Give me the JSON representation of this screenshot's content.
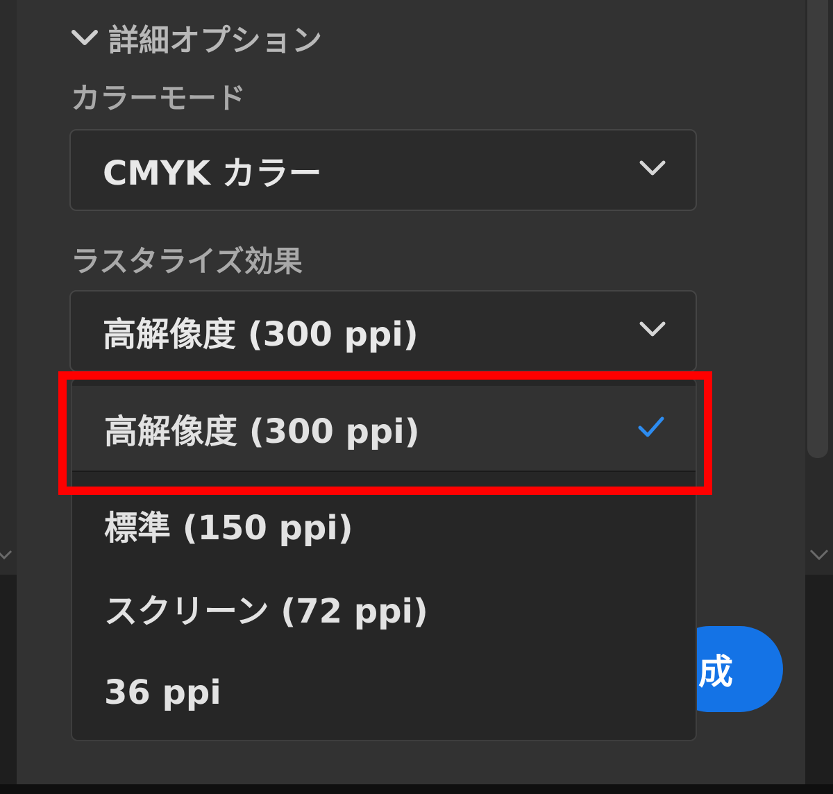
{
  "advanced_options": {
    "title": "詳細オプション"
  },
  "color_mode": {
    "label": "カラーモード",
    "value": "CMYK カラー"
  },
  "raster_effects": {
    "label": "ラスタライズ効果",
    "value": "高解像度 (300 ppi)",
    "options": [
      {
        "label": "高解像度 (300 ppi)",
        "selected": true
      },
      {
        "label": "標準 (150 ppi)",
        "selected": false
      },
      {
        "label": "スクリーン (72 ppi)",
        "selected": false
      },
      {
        "label": "36 ppi",
        "selected": false
      }
    ]
  },
  "actions": {
    "create_partial": "成"
  },
  "colors": {
    "accent": "#1473e6",
    "highlight": "#ff0000",
    "check": "#2d8cf0"
  },
  "icons": {
    "section_toggle": "chevron-down-icon",
    "select_arrow": "chevron-down-icon",
    "selected_mark": "checkmark-icon"
  }
}
